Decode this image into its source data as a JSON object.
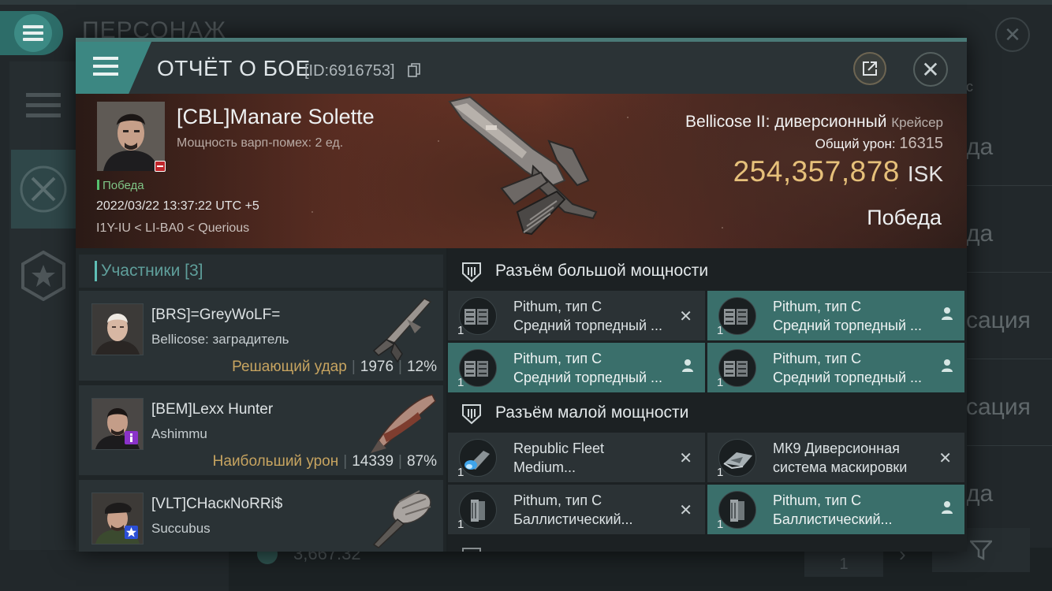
{
  "background": {
    "title": "ПЕРСОНАЖ",
    "right_labels": [
      "да",
      "да",
      "сация",
      "сация",
      "да"
    ],
    "right_top_fragment": "с",
    "bottom_value": "3,667.32",
    "bottom_field": "1"
  },
  "header": {
    "title": "ОТЧЁТ О БОЕ",
    "id": "[ID:6916753]"
  },
  "victim": {
    "name": "[CBL]Manare Solette",
    "warp_disrupt": "Мощность варп-помех: 2 ед.",
    "result": "Победа",
    "datetime": "2022/03/22 13:37:22 UTC +5",
    "location": "I1Y-IU < LI-BA0 < Querious",
    "ship_name": "Bellicose II: диверсионный",
    "ship_class": "Крейсер",
    "total_damage_label": "Общий урон:",
    "total_damage": "16315",
    "isk_value": "254,357,878",
    "isk_unit": "ISK",
    "outcome": "Победа"
  },
  "participants": {
    "title": "Участники [3]",
    "rows": [
      {
        "name": "[BRS]=GreyWoLF=",
        "ship": "Bellicose: заградитель",
        "label": "Решающий удар",
        "damage": "1976",
        "percent": "12%",
        "badge_color": "#000000"
      },
      {
        "name": "[BEM]Lexx Hunter",
        "ship": "Ashimmu",
        "label": "Наибольший урон",
        "damage": "14339",
        "percent": "87%",
        "badge_color": "#8a32c9"
      },
      {
        "name": "[VLT]CHacкNoRRi$",
        "ship": "Succubus",
        "label": "",
        "damage": "",
        "percent": "",
        "badge_color": "#2b4fd6"
      }
    ]
  },
  "fitting": {
    "high_slots_title": "Разъём большой мощности",
    "low_slots_title": "Разъём малой мощности",
    "high_modules": [
      {
        "line1": "Pithum, тип C",
        "line2": "Средний торпедный ...",
        "qty": "1",
        "state": "destroyed",
        "icon": "torpedo-launcher-icon"
      },
      {
        "line1": "Pithum, тип C",
        "line2": "Средний торпедный ...",
        "qty": "1",
        "state": "dropped",
        "icon": "torpedo-launcher-icon"
      },
      {
        "line1": "Pithum, тип C",
        "line2": "Средний торпедный ...",
        "qty": "1",
        "state": "dropped",
        "icon": "torpedo-launcher-icon"
      },
      {
        "line1": "Pithum, тип C",
        "line2": "Средний торпедный ...",
        "qty": "1",
        "state": "dropped",
        "icon": "torpedo-launcher-icon"
      }
    ],
    "low_modules": [
      {
        "line1": "Republic Fleet",
        "line2": "Medium...",
        "qty": "1",
        "state": "destroyed",
        "icon": "microwarpdrive-icon"
      },
      {
        "line1": "МК9 Диверсионная",
        "line2": "система маскировки",
        "qty": "1",
        "state": "destroyed",
        "icon": "cloak-icon"
      },
      {
        "line1": "Pithum, тип C",
        "line2": "Баллистический...",
        "qty": "1",
        "state": "destroyed",
        "icon": "ballistic-control-icon"
      },
      {
        "line1": "Pithum, тип C",
        "line2": "Баллистический...",
        "qty": "1",
        "state": "dropped",
        "icon": "ballistic-control-icon"
      }
    ],
    "state_legend": {
      "destroyed": "✕",
      "dropped": "person-icon"
    }
  },
  "colors": {
    "accent": "#3c8782",
    "highlight_row": "#3a6f6b",
    "isk_gold": "#e6c07a",
    "stat_label": "#c7a460",
    "victory_green": "#56c16f"
  }
}
